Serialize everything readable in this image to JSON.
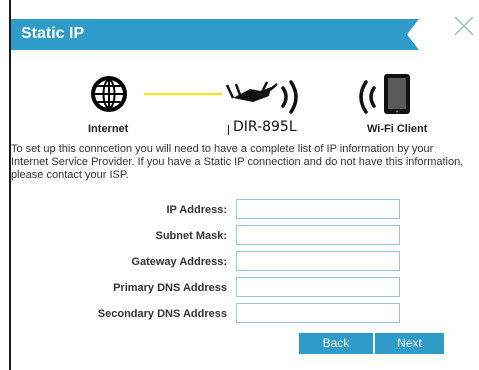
{
  "banner": {
    "title": "Static IP",
    "color": "#2f9bc8"
  },
  "close_icon": "close-icon",
  "diagram": {
    "internet_label": "Internet",
    "device_label": "DIR-895L",
    "client_label": "Wi-Fi Client",
    "link_color": "#f0e040"
  },
  "description": "To set up this conncetion you will need to have a complete list of IP information by your Internet Service Provider. If you have a Static IP connection and do not have this information, please contact your ISP.",
  "form": {
    "fields": [
      {
        "label": "IP Address:",
        "value": ""
      },
      {
        "label": "Subnet Mask:",
        "value": ""
      },
      {
        "label": "Gateway Address:",
        "value": ""
      },
      {
        "label": "Primary DNS Address",
        "value": ""
      },
      {
        "label": "Secondary DNS Address",
        "value": ""
      }
    ]
  },
  "buttons": {
    "back_label": "Back",
    "next_label": "Next"
  }
}
